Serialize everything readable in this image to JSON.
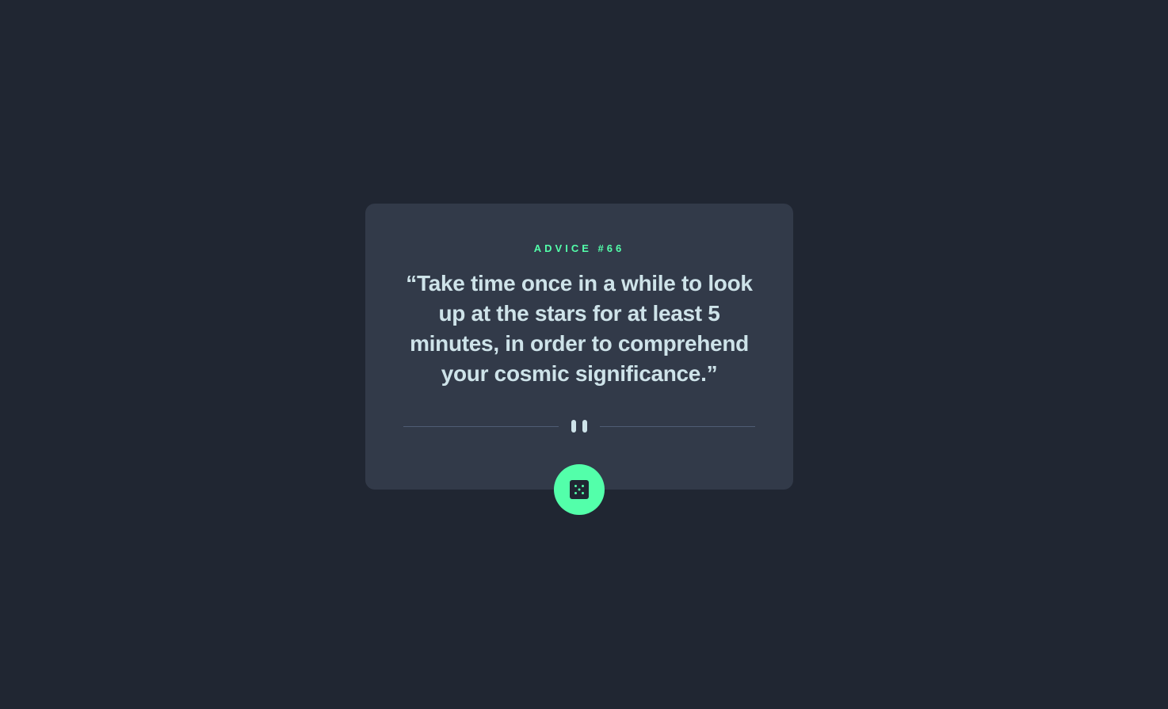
{
  "card": {
    "advice_label": "Advice #66",
    "advice_text": "“Take time once in a while to look up at the stars for at least 5 minutes, in order to comprehend your cosmic significance.”"
  },
  "divider": {
    "icon": "pause-icon"
  },
  "dice_button": {
    "icon": "dice-icon"
  },
  "colors": {
    "background": "#202632",
    "card": "#323a49",
    "accent": "#53ffaa",
    "text": "#cee3e9",
    "divider": "#4f5d74"
  }
}
